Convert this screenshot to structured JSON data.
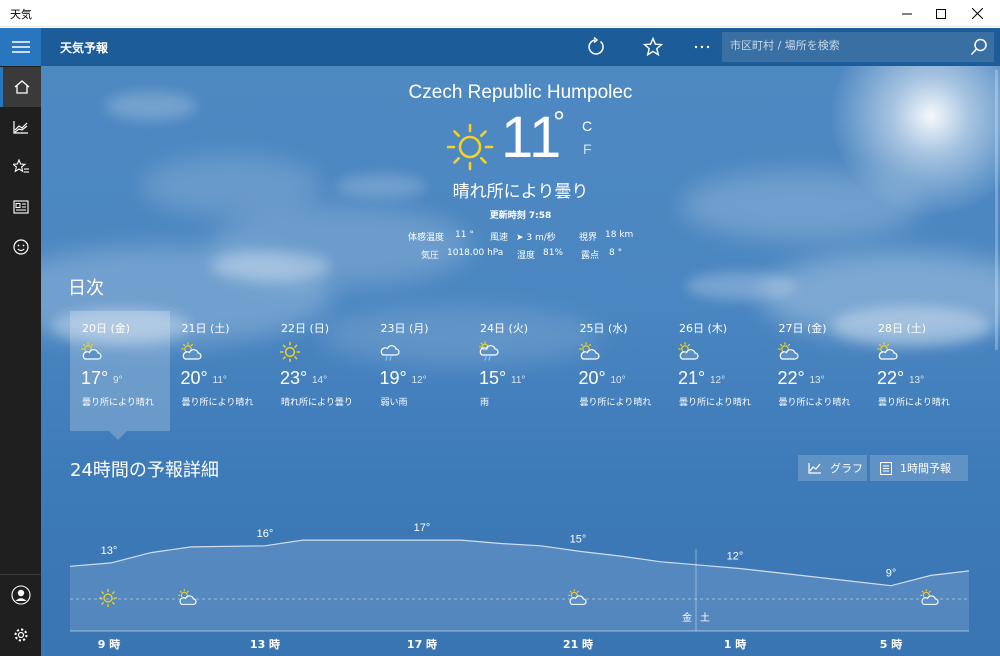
{
  "window": {
    "title": "天気"
  },
  "header": {
    "app_title": "天気予報",
    "search_placeholder": "市区町村 / 場所を検索"
  },
  "current": {
    "location": "Czech Republic Humpolec",
    "temp": "11",
    "deg": "°",
    "unit_c": "C",
    "unit_f": "F",
    "condition": "晴れ所により曇り",
    "updated": "更新時刻 7:58",
    "details_row1": [
      {
        "label": "体感温度",
        "value": "11 °"
      },
      {
        "label": "風速",
        "value": "➤ 3 m/秒"
      },
      {
        "label": "視界",
        "value": "18 km"
      }
    ],
    "details_row2": [
      {
        "label": "気圧",
        "value": "1018.00 hPa"
      },
      {
        "label": "湿度",
        "value": "81%"
      },
      {
        "label": "露点",
        "value": "8 °"
      }
    ]
  },
  "daily": {
    "title": "日次",
    "days": [
      {
        "date": "20日 (金)",
        "hi": "17°",
        "lo": "9°",
        "cond": "曇り所により晴れ",
        "icon": "partly-cloudy-icon"
      },
      {
        "date": "21日 (土)",
        "hi": "20°",
        "lo": "11°",
        "cond": "曇り所により晴れ",
        "icon": "partly-cloudy-icon"
      },
      {
        "date": "22日 (日)",
        "hi": "23°",
        "lo": "14°",
        "cond": "晴れ所により曇り",
        "icon": "sun-icon"
      },
      {
        "date": "23日 (月)",
        "hi": "19°",
        "lo": "12°",
        "cond": "弱い雨",
        "icon": "light-rain-icon"
      },
      {
        "date": "24日 (火)",
        "hi": "15°",
        "lo": "11°",
        "cond": "雨",
        "icon": "rain-icon"
      },
      {
        "date": "25日 (水)",
        "hi": "20°",
        "lo": "10°",
        "cond": "曇り所により晴れ",
        "icon": "partly-cloudy-icon"
      },
      {
        "date": "26日 (木)",
        "hi": "21°",
        "lo": "12°",
        "cond": "曇り所により晴れ",
        "icon": "partly-cloudy-icon"
      },
      {
        "date": "27日 (金)",
        "hi": "22°",
        "lo": "13°",
        "cond": "曇り所により晴れ",
        "icon": "partly-cloudy-icon"
      },
      {
        "date": "28日 (土)",
        "hi": "22°",
        "lo": "13°",
        "cond": "曇り所により晴れ",
        "icon": "partly-cloudy-icon"
      }
    ]
  },
  "hourly": {
    "title": "24時間の予報詳細",
    "graph_label": "グラフ",
    "hourly_label": "1時間予報",
    "day_marker_left": "金",
    "day_marker_right": "土",
    "time_labels": [
      "9 時",
      "13 時",
      "17 時",
      "21 時",
      "1 時",
      "5 時"
    ]
  },
  "chart_data": {
    "type": "area",
    "temp_labels": [
      "13°",
      "16°",
      "17°",
      "15°",
      "12°",
      "9°"
    ],
    "temperatures": [
      {
        "label": "13°",
        "value": 13
      },
      {
        "label": "16°",
        "value": 16
      },
      {
        "label": "17°",
        "value": 17
      },
      {
        "label": "15°",
        "value": 15
      },
      {
        "label": "12°",
        "value": 12
      },
      {
        "label": "9°",
        "value": 9
      }
    ],
    "icons": [
      "sun-icon",
      "partly-cloudy-icon",
      "partly-cloudy-icon",
      "partly-cloudy-icon"
    ],
    "x_labels": [
      "9 時",
      "13 時",
      "17 時",
      "21 時",
      "1 時",
      "5 時"
    ]
  },
  "colors": {
    "header_bg": "#1c5c98",
    "accent": "#2876c0",
    "rail_bg": "#1f1f1f",
    "sun": "#f5d31d"
  }
}
